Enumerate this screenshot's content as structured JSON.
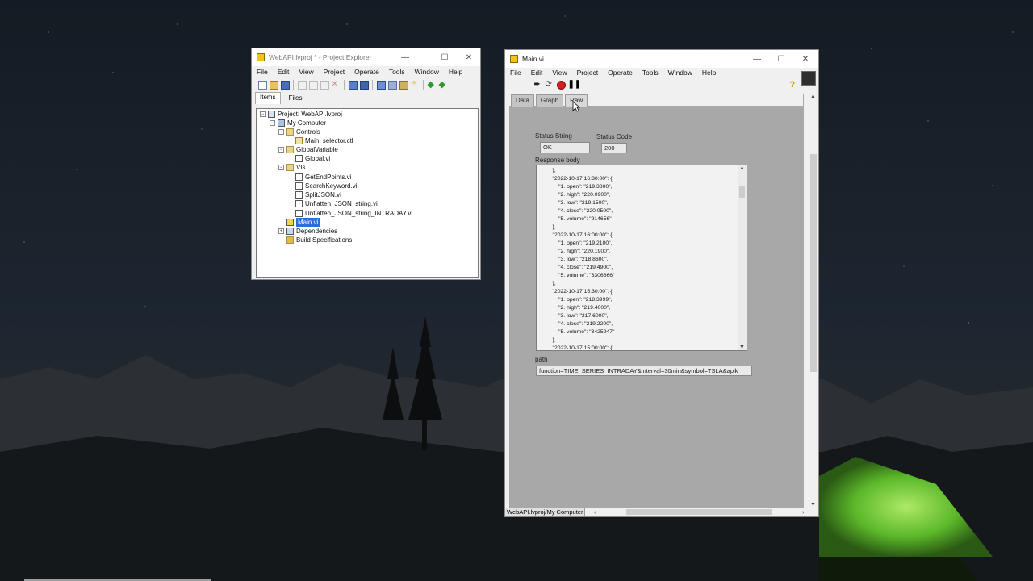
{
  "project_explorer": {
    "title": "WebAPI.lvproj * - Project Explorer",
    "menu": [
      "File",
      "Edit",
      "View",
      "Project",
      "Operate",
      "Tools",
      "Window",
      "Help"
    ],
    "tabs": [
      "Items",
      "Files"
    ],
    "tree": [
      {
        "label": "Project: WebAPI.lvproj",
        "icon": "project-icon"
      },
      {
        "label": "My Computer",
        "icon": "computer-icon"
      },
      {
        "label": "Controls",
        "icon": "folder-icon"
      },
      {
        "label": "Main_selector.ctl",
        "icon": "control-icon"
      },
      {
        "label": "GlobalVariable",
        "icon": "folder-icon"
      },
      {
        "label": "Global.vi",
        "icon": "vi-icon"
      },
      {
        "label": "VIs",
        "icon": "folder-icon"
      },
      {
        "label": "GetEndPoints.vi",
        "icon": "vi-icon"
      },
      {
        "label": "SearchKeyword.vi",
        "icon": "vi-icon"
      },
      {
        "label": "SplitJSON.vi",
        "icon": "vi-icon"
      },
      {
        "label": "Unflatten_JSON_string.vi",
        "icon": "vi-icon"
      },
      {
        "label": "Unflatten_JSON_string_INTRADAY.vi",
        "icon": "vi-icon"
      },
      {
        "label": "Main.vi",
        "icon": "vi-icon"
      },
      {
        "label": "Dependencies",
        "icon": "dependencies-icon"
      },
      {
        "label": "Build Specifications",
        "icon": "build-icon"
      }
    ]
  },
  "main_vi": {
    "title": "Main.vi",
    "menu": [
      "File",
      "Edit",
      "View",
      "Project",
      "Operate",
      "Tools",
      "Window",
      "Help"
    ],
    "tabs": [
      "Data",
      "Graph",
      "Raw"
    ],
    "active_tab": "Raw",
    "status_string_label": "Status String",
    "status_string_value": "OK",
    "status_code_label": "Status Code",
    "status_code_value": "200",
    "response_body_label": "Response body",
    "response_body_text": "    },\n    \"2022-10-17 16:30:00\": {\n        \"1. open\": \"219.3800\",\n        \"2. high\": \"220.0900\",\n        \"3. low\": \"219.1500\",\n        \"4. close\": \"220.0500\",\n        \"5. volume\": \"914656\"\n    },\n    \"2022-10-17 16:00:00\": {\n        \"1. open\": \"219.2100\",\n        \"2. high\": \"220.1900\",\n        \"3. low\": \"218.8600\",\n        \"4. close\": \"219.4900\",\n        \"5. volume\": \"6306866\"\n    },\n    \"2022-10-17 15:30:00\": {\n        \"1. open\": \"218.3999\",\n        \"2. high\": \"219.4000\",\n        \"3. low\": \"217.6000\",\n        \"4. close\": \"219.2200\",\n        \"5. volume\": \"3425947\"\n    },\n    \"2022-10-17 15:00:00\": {",
    "path_label": "path",
    "path_value": "function=TIME_SERIES_INTRADAY&interval=30min&symbol=TSLA&apik",
    "status_bar": "WebAPI.lvproj/My Computer"
  },
  "colors": {
    "selection": "#2b6ed6",
    "panel": "#a8a8a8",
    "tent_glow": "#7fe23a"
  }
}
